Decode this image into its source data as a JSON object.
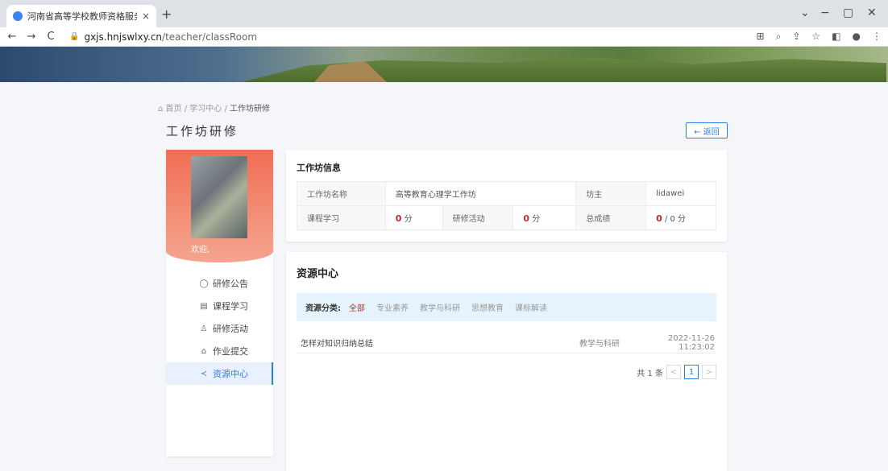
{
  "browser": {
    "tab_title": "河南省高等学校教师资格服务云",
    "tab_close": "×",
    "new_tab": "+",
    "url_host": "gxjs.hnjswlxy.cn",
    "url_path": "/teacher/classRoom",
    "nav": {
      "back": "←",
      "forward": "→",
      "reload": "C"
    },
    "window": {
      "menu": "⌄",
      "minimize": "−",
      "restore": "▢",
      "close": "✕"
    }
  },
  "breadcrumb": {
    "home": "首页",
    "sep": "/",
    "study": "学习中心",
    "current": "工作坊研修"
  },
  "page_title": "工作坊研修",
  "back_button": "← 返回",
  "sidebar": {
    "welcome": "欢迎,",
    "items": [
      {
        "icon": "◯",
        "label": "研修公告"
      },
      {
        "icon": "▤",
        "label": "课程学习"
      },
      {
        "icon": "♙",
        "label": "研修活动"
      },
      {
        "icon": "⌂",
        "label": "作业提交"
      },
      {
        "icon": "≺",
        "label": "资源中心",
        "active": true
      }
    ]
  },
  "workshop": {
    "title": "工作坊信息",
    "name_label": "工作坊名称",
    "name_value": "高等教育心理学工作坊",
    "host_label": "坊主",
    "host_value": "lidawei",
    "course_label": "课程学习",
    "course_score": "0",
    "course_unit": "分",
    "activity_label": "研修活动",
    "activity_score": "0",
    "activity_unit": "分",
    "total_label": "总成绩",
    "total_score": "0",
    "total_unit": "/ 0 分"
  },
  "resources": {
    "title": "资源中心",
    "filter_label": "资源分类:",
    "filters": [
      "全部",
      "专业素养",
      "教学与科研",
      "思想教育",
      "课标解读"
    ],
    "rows": [
      {
        "name": "怎样对知识归纳总结",
        "category": "教学与科研",
        "time": "2022-11-26 11:23:02"
      }
    ],
    "pager": {
      "total": "共 1 条",
      "prev": "<",
      "page": "1",
      "next": ">"
    }
  }
}
